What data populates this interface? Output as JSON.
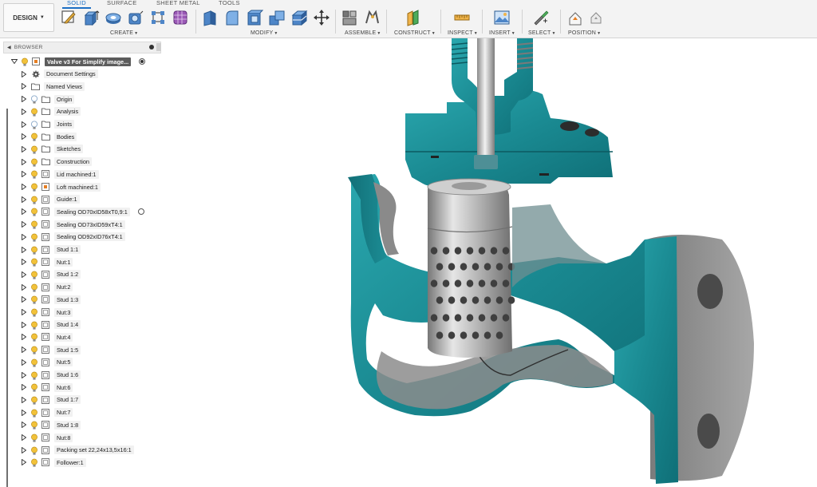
{
  "toolbar": {
    "workspace": "DESIGN",
    "tabs": [
      {
        "label": "SOLID",
        "active": true
      },
      {
        "label": "SURFACE",
        "active": false
      },
      {
        "label": "SHEET METAL",
        "active": false
      },
      {
        "label": "TOOLS",
        "active": false
      }
    ],
    "groups": [
      {
        "label": "CREATE"
      },
      {
        "label": "MODIFY"
      },
      {
        "label": "ASSEMBLE"
      },
      {
        "label": "CONSTRUCT"
      },
      {
        "label": "INSPECT"
      },
      {
        "label": "INSERT"
      },
      {
        "label": "SELECT"
      },
      {
        "label": "POSITION"
      }
    ]
  },
  "browser": {
    "title": "BROWSER",
    "root": "Valve v3 For Simplify image...",
    "items": [
      {
        "label": "Document Settings",
        "icon": "gear-icon"
      },
      {
        "label": "Named Views",
        "icon": "folder-icon"
      },
      {
        "label": "Origin",
        "icon": "folder-icon"
      },
      {
        "label": "Analysis",
        "icon": "folder-icon"
      },
      {
        "label": "Joints",
        "icon": "folder-icon"
      },
      {
        "label": "Bodies",
        "icon": "folder-icon"
      },
      {
        "label": "Sketches",
        "icon": "folder-icon"
      },
      {
        "label": "Construction",
        "icon": "folder-icon"
      },
      {
        "label": "Lid machined:1",
        "icon": "component-icon"
      },
      {
        "label": "Loft machined:1",
        "icon": "component-link-icon"
      },
      {
        "label": "Guide:1",
        "icon": "component-icon"
      },
      {
        "label": "Sealing OD70xID58xT0,9:1",
        "icon": "component-icon"
      },
      {
        "label": "Sealing OD73xID59xT4:1",
        "icon": "component-icon"
      },
      {
        "label": "Sealing OD92xID76xT4:1",
        "icon": "component-icon"
      },
      {
        "label": "Stud 1:1",
        "icon": "component-icon"
      },
      {
        "label": "Nut:1",
        "icon": "component-icon"
      },
      {
        "label": "Stud 1:2",
        "icon": "component-icon"
      },
      {
        "label": "Nut:2",
        "icon": "component-icon"
      },
      {
        "label": "Stud 1:3",
        "icon": "component-icon"
      },
      {
        "label": "Nut:3",
        "icon": "component-icon"
      },
      {
        "label": "Stud 1:4",
        "icon": "component-icon"
      },
      {
        "label": "Nut:4",
        "icon": "component-icon"
      },
      {
        "label": "Stud 1:5",
        "icon": "component-icon"
      },
      {
        "label": "Nut:5",
        "icon": "component-icon"
      },
      {
        "label": "Stud 1:6",
        "icon": "component-icon"
      },
      {
        "label": "Nut:6",
        "icon": "component-icon"
      },
      {
        "label": "Stud 1:7",
        "icon": "component-icon"
      },
      {
        "label": "Nut:7",
        "icon": "component-icon"
      },
      {
        "label": "Stud 1:8",
        "icon": "component-icon"
      },
      {
        "label": "Nut:8",
        "icon": "component-icon"
      },
      {
        "label": "Packing set 22,24x13,5x16:1",
        "icon": "component-icon"
      },
      {
        "label": "Follower:1",
        "icon": "component-icon"
      }
    ]
  },
  "colors": {
    "accent": "#1d6fc4",
    "teal_section": "#1e8a91",
    "steel": "#a9a9a9"
  }
}
